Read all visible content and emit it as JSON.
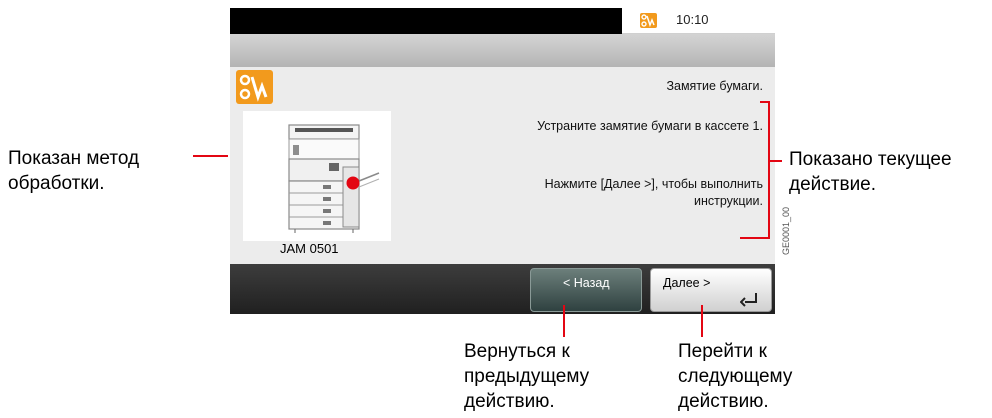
{
  "status_bar": {
    "time": "10:10"
  },
  "error": {
    "title": "Замятие бумаги.",
    "step1": "Устраните замятие бумаги в кассете 1.",
    "step2": "Нажмите [Далее >], чтобы выполнить инструкции.",
    "code": "JAM 0501"
  },
  "buttons": {
    "back_label": "< Назад",
    "next_label": "Далее >"
  },
  "figure_code": "GE0001_00",
  "callouts": {
    "method": "Показан метод обработки.",
    "current": "Показано текущее действие.",
    "back": "Вернуться к предыдущему действию.",
    "next": "Перейти к следующему действию."
  },
  "colors": {
    "accent": "#f29a1d",
    "callout_line": "#e30613"
  }
}
